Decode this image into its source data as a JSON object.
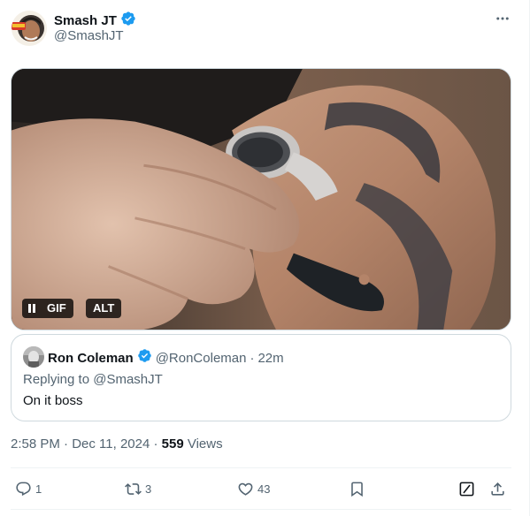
{
  "author": {
    "display_name": "Smash JT",
    "handle": "@SmashJT",
    "verified": true,
    "avatar_icon": "avatar-smashjt"
  },
  "media": {
    "type": "GIF",
    "gif_label": "GIF",
    "alt_label": "ALT",
    "playing": true
  },
  "quoted_post": {
    "display_name": "Ron Coleman",
    "handle": "@RonColeman",
    "separator": "·",
    "time_ago": "22m",
    "replying_to": "Replying to @SmashJT",
    "text": "On it boss",
    "verified": true
  },
  "meta": {
    "timestamp": "2:58 PM · Dec 11, 2024",
    "separator": "·",
    "views_count": "559",
    "views_label": "Views"
  },
  "actions": {
    "replies": "1",
    "reposts": "3",
    "likes": "43"
  },
  "colors": {
    "verified_blue": "#1d9bf0",
    "text_secondary": "#536471",
    "border": "#cfd9de"
  }
}
